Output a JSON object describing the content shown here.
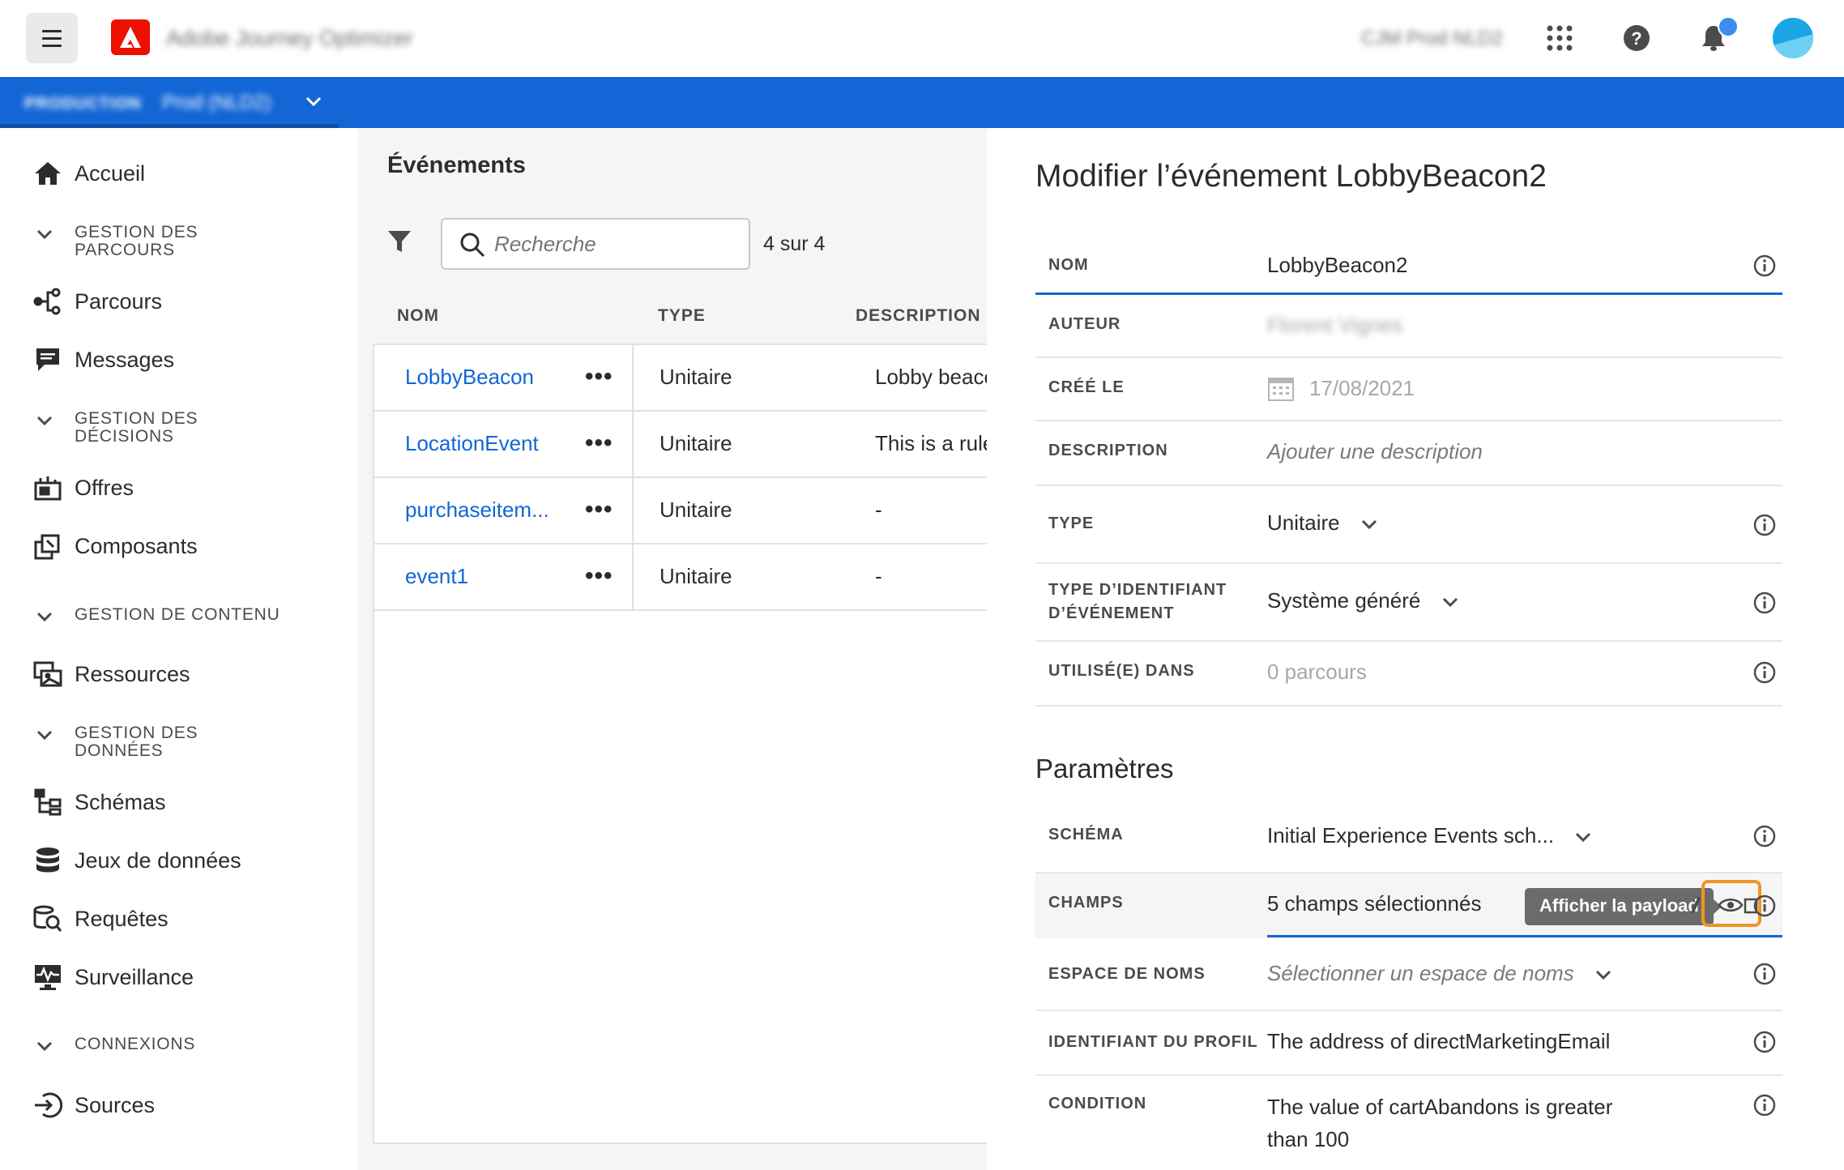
{
  "topbar": {
    "app_title": "Adobe Journey Optimizer",
    "org_name": "CJM Prod NLD2"
  },
  "sandbox": {
    "label": "PRODUCTION",
    "name": "Prod (NLD2)"
  },
  "sidebar": {
    "home": "Accueil",
    "section_journeys": "GESTION DES PARCOURS",
    "journeys": "Parcours",
    "messages": "Messages",
    "section_decisions": "GESTION DES DÉCISIONS",
    "offers": "Offres",
    "components": "Composants",
    "section_content": "GESTION DE CONTENU",
    "assets": "Ressources",
    "section_data": "GESTION DES DONNÉES",
    "schemas": "Schémas",
    "datasets": "Jeux de données",
    "queries": "Requêtes",
    "monitoring": "Surveillance",
    "section_connections": "CONNEXIONS",
    "sources": "Sources"
  },
  "events_list": {
    "title": "Événements",
    "search_placeholder": "Recherche",
    "count": "4 sur 4",
    "col_name": "NOM",
    "col_type": "TYPE",
    "col_description": "DESCRIPTION",
    "rows": [
      {
        "name": "LobbyBeacon",
        "type": "Unitaire",
        "description": "Lobby beacon"
      },
      {
        "name": "LocationEvent",
        "type": "Unitaire",
        "description": "This is a rule-b"
      },
      {
        "name": "purchaseitem...",
        "type": "Unitaire",
        "description": "-"
      },
      {
        "name": "event1",
        "type": "Unitaire",
        "description": "-"
      }
    ]
  },
  "edit_panel": {
    "title": "Modifier l’événement LobbyBeacon2",
    "name_label": "NOM",
    "name_value": "LobbyBeacon2",
    "author_label": "AUTEUR",
    "author_value": "Florent Vignes",
    "created_label": "CRÉÉ LE",
    "created_value": "17/08/2021",
    "description_label": "DESCRIPTION",
    "description_placeholder": "Ajouter une description",
    "type_label": "TYPE",
    "type_value": "Unitaire",
    "id_type_label": "TYPE D’IDENTIFIANT D’ÉVÉNEMENT",
    "id_type_value": "Système généré",
    "used_in_label": "UTILISÉ(E) DANS",
    "used_in_value": "0 parcours",
    "params_title": "Paramètres",
    "schema_label": "SCHÉMA",
    "schema_value": "Initial Experience Events sch...",
    "fields_label": "CHAMPS",
    "fields_value": "5 champs sélectionnés",
    "tooltip": "Afficher la payload",
    "namespace_label": "ESPACE DE NOMS",
    "namespace_placeholder": "Sélectionner un espace de noms",
    "profile_id_label": "IDENTIFIANT DU PROFIL",
    "profile_id_value": "The address of directMarketingEmail",
    "condition_label": "CONDITION",
    "condition_value": "The value of cartAbandons is greater than 100"
  },
  "colors": {
    "accent_blue": "#1266d6",
    "adobe_red": "#eb1000",
    "highlight_orange": "#f29423"
  }
}
